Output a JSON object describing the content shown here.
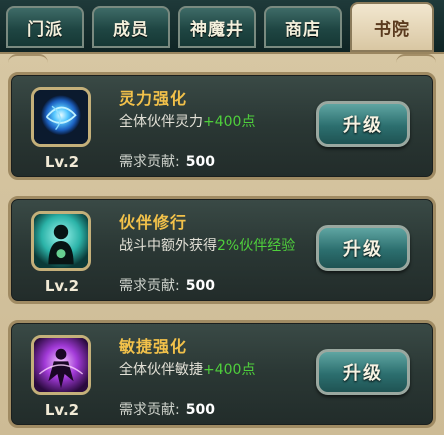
{
  "tabs": [
    {
      "label": "门派",
      "active": false
    },
    {
      "label": "成员",
      "active": false
    },
    {
      "label": "神魔井",
      "active": false
    },
    {
      "label": "商店",
      "active": false
    },
    {
      "label": "书院",
      "active": true
    }
  ],
  "skills": [
    {
      "icon": "blue-energy-orb-icon",
      "level": "Lv.2",
      "title": "灵力强化",
      "desc_prefix": "全体伙伴灵力",
      "desc_highlight": "+400点",
      "desc_suffix": "",
      "cost_label": "需求贡献:",
      "cost_value": "500",
      "button": "升级"
    },
    {
      "icon": "meditating-silhouette-icon",
      "level": "Lv.2",
      "title": "伙伴修行",
      "desc_prefix": "战斗中额外获得",
      "desc_highlight": "2%伙伴经验",
      "desc_suffix": "",
      "cost_label": "需求贡献:",
      "cost_value": "500",
      "button": "升级"
    },
    {
      "icon": "purple-agility-figure-icon",
      "level": "Lv.2",
      "title": "敏捷强化",
      "desc_prefix": "全体伙伴敏捷",
      "desc_highlight": "+400点",
      "desc_suffix": "",
      "cost_label": "需求贡献:",
      "cost_value": "500",
      "button": "升级"
    }
  ],
  "colors": {
    "title": "#f2c14a",
    "highlight": "#4fcf3c",
    "panel": "#d7c7a3",
    "card": "#2a3734"
  }
}
